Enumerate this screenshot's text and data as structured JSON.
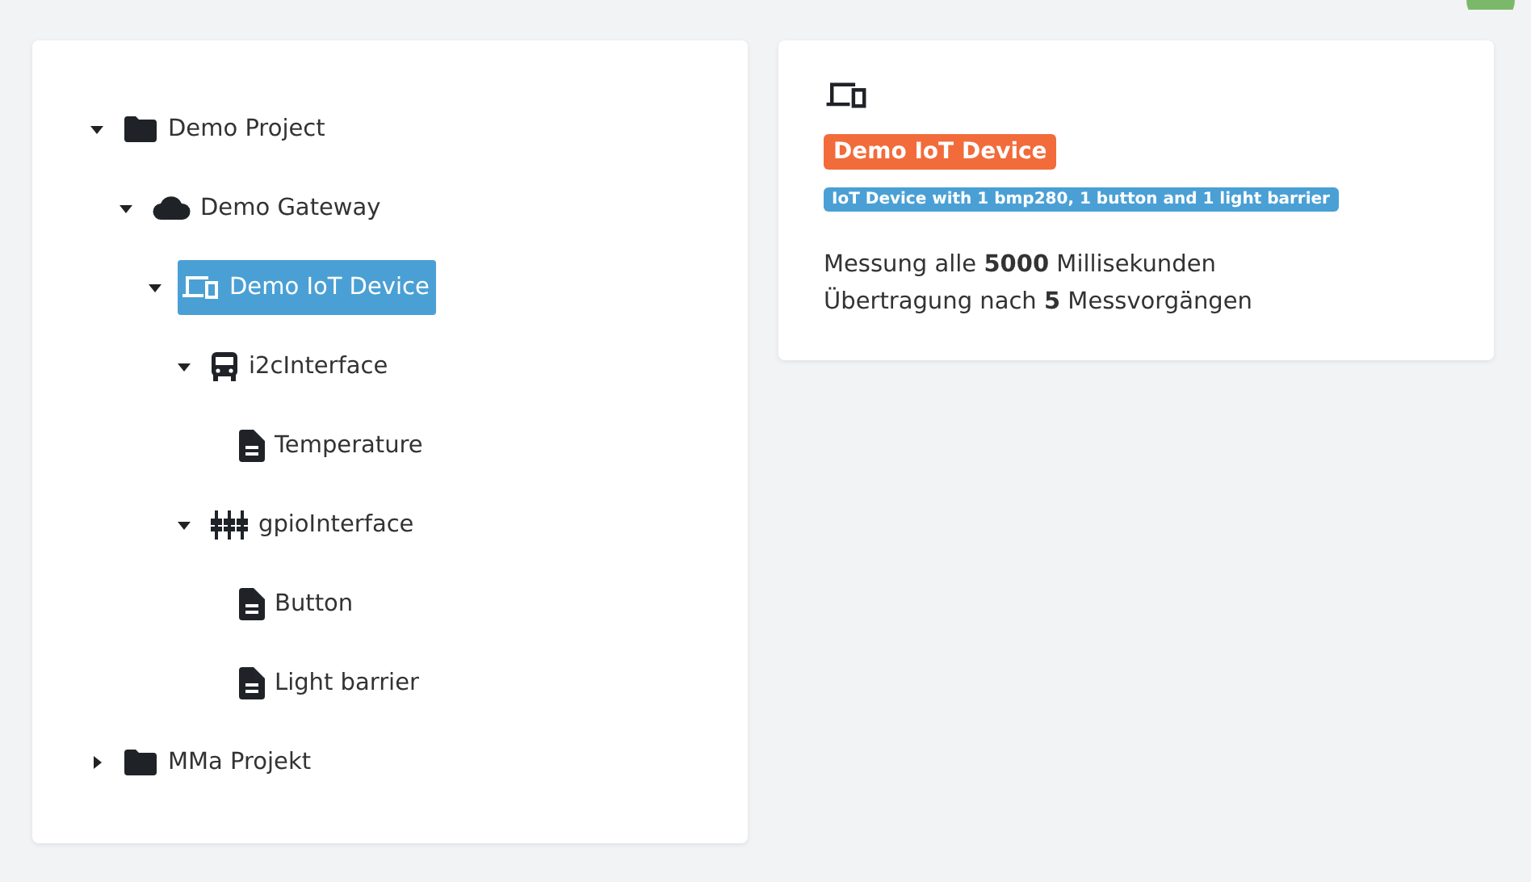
{
  "tree": [
    {
      "label": "Demo Project",
      "kind": "project",
      "expanded": true,
      "selected": false,
      "children": [
        {
          "label": "Demo Gateway",
          "kind": "gateway",
          "expanded": true,
          "selected": false,
          "children": [
            {
              "label": "Demo IoT Device",
              "kind": "device",
              "expanded": true,
              "selected": true,
              "children": [
                {
                  "label": "i2cInterface",
                  "kind": "bus",
                  "expanded": true,
                  "selected": false,
                  "children": [
                    {
                      "label": "Temperature",
                      "kind": "sensor",
                      "selected": false
                    }
                  ]
                },
                {
                  "label": "gpioInterface",
                  "kind": "gpio",
                  "expanded": true,
                  "selected": false,
                  "children": [
                    {
                      "label": "Button",
                      "kind": "sensor",
                      "selected": false
                    },
                    {
                      "label": "Light barrier",
                      "kind": "sensor",
                      "selected": false
                    }
                  ]
                }
              ]
            }
          ]
        }
      ]
    },
    {
      "label": "MMa Projekt",
      "kind": "project",
      "expanded": false,
      "selected": false
    }
  ],
  "detail": {
    "kind": "device",
    "name": "Demo IoT Device",
    "description": "IoT Device with 1 bmp280, 1 button and 1 light barrier",
    "lines": [
      "Messung alle **5000** Millisekunden",
      "Übertragung nach **5** Messvorgängen"
    ]
  }
}
